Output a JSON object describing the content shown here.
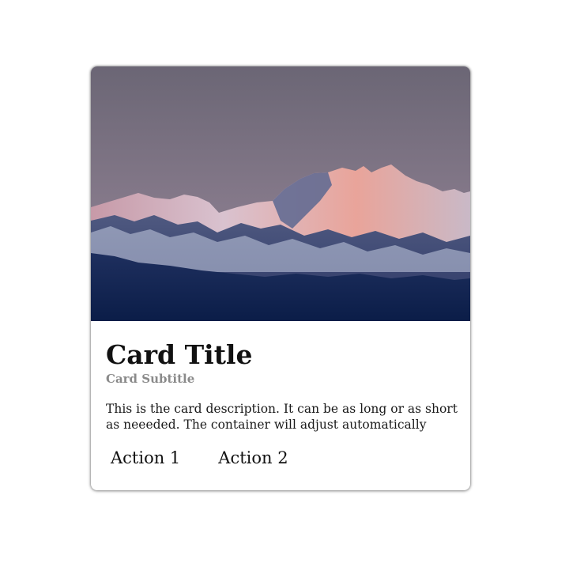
{
  "card": {
    "title": "Card Title",
    "subtitle": "Card Subtitle",
    "description": "This is the card description. It can be as long or as short as neeeded. The container will adjust automatically",
    "image": {
      "alt": "",
      "sky_top": "#6e6877",
      "sky_bottom": "#8a7e8c",
      "peak_glow": "#f09a8f",
      "snow": "#c9cee0",
      "base": "#0c2452"
    },
    "actions": [
      {
        "label": "Action 1"
      },
      {
        "label": "Action 2"
      }
    ]
  }
}
